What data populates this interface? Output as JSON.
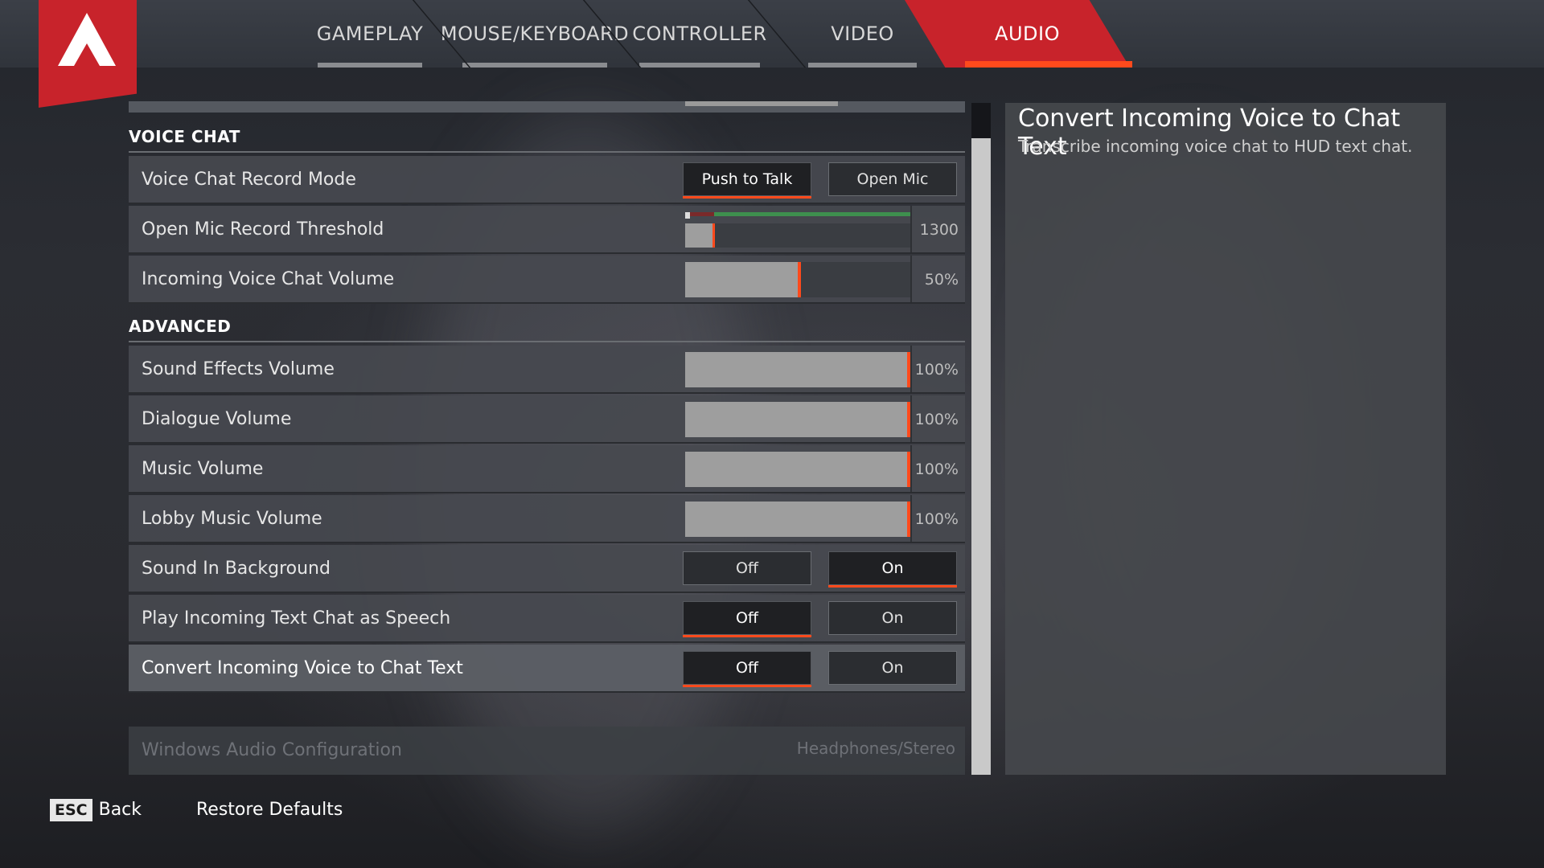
{
  "tabs": [
    {
      "label": "GAMEPLAY"
    },
    {
      "label": "MOUSE/KEYBOARD"
    },
    {
      "label": "CONTROLLER"
    },
    {
      "label": "VIDEO"
    },
    {
      "label": "AUDIO",
      "active": true
    }
  ],
  "sections": {
    "voice_chat": "VOICE CHAT",
    "advanced": "ADVANCED"
  },
  "voice_chat": {
    "record_mode": {
      "label": "Voice Chat Record Mode",
      "option1": "Push to Talk",
      "option2": "Open Mic",
      "selected": "Push to Talk"
    },
    "threshold": {
      "label": "Open Mic Record Threshold",
      "value": "1300"
    },
    "incoming_volume": {
      "label": "Incoming Voice Chat Volume",
      "value": "50%",
      "level": 0.5
    }
  },
  "advanced": {
    "sfx": {
      "label": "Sound Effects Volume",
      "value": "100%",
      "level": 1.0
    },
    "dialogue": {
      "label": "Dialogue Volume",
      "value": "100%",
      "level": 1.0
    },
    "music": {
      "label": "Music Volume",
      "value": "100%",
      "level": 1.0
    },
    "lobby_music": {
      "label": "Lobby Music Volume",
      "value": "100%",
      "level": 1.0
    },
    "sound_bg": {
      "label": "Sound In Background",
      "off": "Off",
      "on": "On",
      "selected": "On"
    },
    "text_speech": {
      "label": "Play Incoming Text Chat as Speech",
      "off": "Off",
      "on": "On",
      "selected": "Off"
    },
    "voice_text": {
      "label": "Convert Incoming Voice to Chat Text",
      "off": "Off",
      "on": "On",
      "selected": "Off"
    }
  },
  "windows_audio": {
    "label": "Windows Audio Configuration",
    "value": "Headphones/Stereo"
  },
  "description": {
    "title": "Convert Incoming Voice to Chat Text",
    "text": "Transcribe incoming voice chat to HUD text chat."
  },
  "footer": {
    "esc_key": "ESC",
    "back": "Back",
    "restore": "Restore Defaults"
  },
  "colors": {
    "accent": "#ff4a1c",
    "brand_red": "#c8232b"
  }
}
